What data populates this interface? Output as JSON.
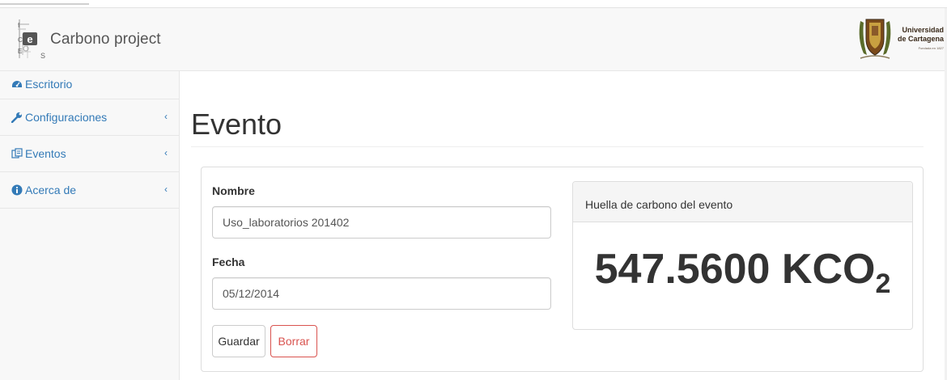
{
  "brand": {
    "title": "Carbono project"
  },
  "university": {
    "line1": "Universidad",
    "line2": "de Cartagena",
    "line3": "Fundada en 1827"
  },
  "sidebar": {
    "items": [
      {
        "label": "Escritorio",
        "icon": "dashboard-icon",
        "has_chevron": false
      },
      {
        "label": "Configuraciones",
        "icon": "wrench-icon",
        "has_chevron": true
      },
      {
        "label": "Eventos",
        "icon": "calendar-icon",
        "has_chevron": true
      },
      {
        "label": "Acerca de",
        "icon": "info-circle-icon",
        "has_chevron": true
      }
    ],
    "chevron": "‹"
  },
  "page": {
    "title": "Evento"
  },
  "form": {
    "name_label": "Nombre",
    "name_value": "Uso_laboratorios 201402",
    "date_label": "Fecha",
    "date_value": "05/12/2014",
    "save_label": "Guardar",
    "delete_label": "Borrar"
  },
  "carbon": {
    "heading": "Huella de carbono del evento",
    "value": "547.5600 KCO",
    "subscript": "2"
  },
  "colors": {
    "link": "#337ab7",
    "danger": "#d9534f",
    "sidebar_bg": "#f8f8f8"
  }
}
